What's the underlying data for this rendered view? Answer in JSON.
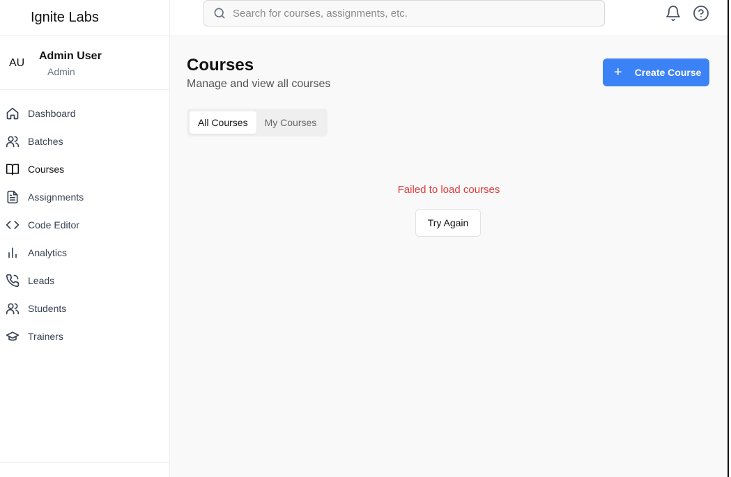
{
  "app": {
    "brand": "Ignite Labs"
  },
  "user": {
    "initials": "AU",
    "name": "Admin User",
    "role": "Admin"
  },
  "sidebar": {
    "items": [
      {
        "label": "Dashboard",
        "icon": "home-icon"
      },
      {
        "label": "Batches",
        "icon": "users-icon"
      },
      {
        "label": "Courses",
        "icon": "book-open-icon",
        "active": true
      },
      {
        "label": "Assignments",
        "icon": "file-text-icon"
      },
      {
        "label": "Code Editor",
        "icon": "code-icon"
      },
      {
        "label": "Analytics",
        "icon": "bar-chart-icon"
      },
      {
        "label": "Leads",
        "icon": "phone-icon"
      },
      {
        "label": "Students",
        "icon": "users-icon"
      },
      {
        "label": "Trainers",
        "icon": "graduation-cap-icon"
      }
    ]
  },
  "header": {
    "search_placeholder": "Search for courses, assignments, etc.",
    "icons": [
      "bell-icon",
      "help-circle-icon"
    ]
  },
  "main": {
    "title": "Courses",
    "subtitle": "Manage and view all courses",
    "create_label": "Create Course",
    "tabs": [
      {
        "label": "All Courses",
        "active": true
      },
      {
        "label": "My Courses",
        "active": false
      }
    ],
    "error_message": "Failed to load courses",
    "retry_label": "Try Again"
  },
  "colors": {
    "accent": "#3b82f6",
    "error": "#e03a3a",
    "background": "#f9f9f9"
  }
}
